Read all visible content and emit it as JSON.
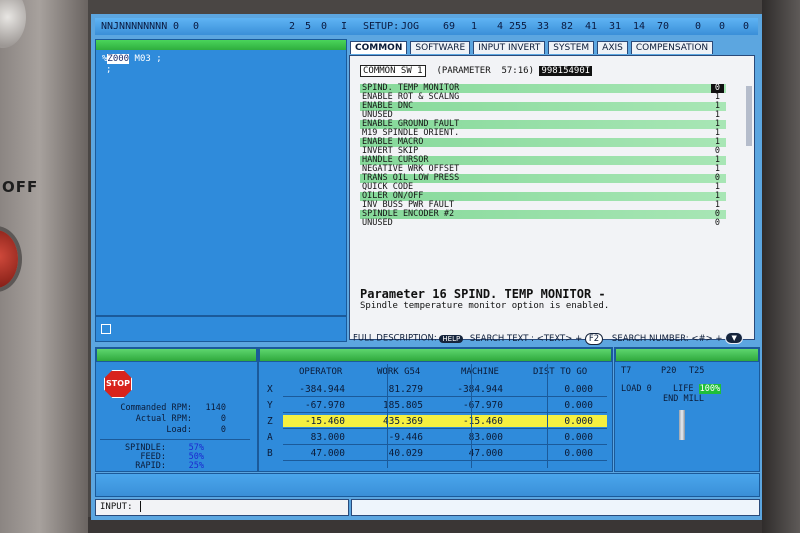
{
  "topbar": {
    "serial": "NNJNNNNNNNN",
    "n0": "0",
    "n1": "0",
    "c2": "2",
    "c5": "5",
    "c0": "0",
    "c1": "I",
    "setup": "SETUP:",
    "mode": "JOG",
    "v1": "69",
    "v2": "1",
    "v3": "4",
    "v4": "255",
    "v5": "33",
    "v6": "82",
    "v7": "41",
    "v8": "31",
    "v9": "14",
    "v10": "70",
    "v11": "0",
    "v12": "0",
    "v13": "0"
  },
  "program": {
    "line1_prefix": "%",
    "line1_block": "Z000",
    "line1_rest": " M03 ;",
    "line2": ";"
  },
  "tabs": [
    "COMMON",
    "SOFTWARE",
    "INPUT INVERT",
    "SYSTEM",
    "AXIS",
    "COMPENSATION"
  ],
  "params": {
    "header_name": "COMMON SW 1",
    "header_param": "(PARAMETER  57:16)",
    "header_value": "99815490I",
    "rows": [
      {
        "label": "SPIND. TEMP MONITOR",
        "value": "0"
      },
      {
        "label": "ENABLE ROT & SCALNG",
        "value": "1"
      },
      {
        "label": "ENABLE DNC",
        "value": "1"
      },
      {
        "label": "UNUSED",
        "value": "1"
      },
      {
        "label": "ENABLE GROUND FAULT",
        "value": "1"
      },
      {
        "label": "M19 SPINDLE ORIENT.",
        "value": "1"
      },
      {
        "label": "ENABLE MACRO",
        "value": "1"
      },
      {
        "label": "INVERT SKIP",
        "value": "0"
      },
      {
        "label": "HANDLE CURSOR",
        "value": "1"
      },
      {
        "label": "NEGATIVE WRK OFFSET",
        "value": "1"
      },
      {
        "label": "TRANS OIL LOW PRESS",
        "value": "0"
      },
      {
        "label": "QUICK CODE",
        "value": "1"
      },
      {
        "label": "OILER ON/OFF",
        "value": "1"
      },
      {
        "label": "INV BUSS PWR FAULT",
        "value": "1"
      },
      {
        "label": "SPINDLE ENCODER #2",
        "value": "0"
      },
      {
        "label": "UNUSED",
        "value": "0"
      }
    ],
    "desc_title": "Parameter 16 SPIND. TEMP MONITOR -",
    "desc_text": "Spindle temperature monitor option is enabled."
  },
  "help_bar": {
    "full_desc": "FULL DESCRIPTION:",
    "help_key": "HELP",
    "search_text": "SEARCH TEXT : <TEXT> +",
    "f2_key": "F2",
    "search_number": "SEARCH NUMBER: <#> +"
  },
  "spindle": {
    "stop_label": "STOP",
    "commanded_rpm_label": "Commanded RPM:",
    "commanded_rpm": "1140",
    "actual_rpm_label": "Actual RPM:",
    "actual_rpm": "0",
    "load_label": "Load:",
    "load": "0",
    "spindle_label": "SPINDLE:",
    "spindle_pct": "57%",
    "feed_label": "FEED:",
    "feed_pct": "50%",
    "rapid_label": "RAPID:",
    "rapid_pct": "25%"
  },
  "positions": {
    "headers": [
      "OPERATOR",
      "WORK G54",
      "MACHINE",
      "DIST TO GO"
    ],
    "rows": [
      {
        "axis": "X",
        "operator": "-384.944",
        "work": "81.279",
        "machine": "-384.944",
        "dist": "0.000"
      },
      {
        "axis": "Y",
        "operator": "-67.970",
        "work": "185.805",
        "machine": "-67.970",
        "dist": "0.000"
      },
      {
        "axis": "Z",
        "operator": "-15.460",
        "work": "435.369",
        "machine": "-15.460",
        "dist": "0.000"
      },
      {
        "axis": "A",
        "operator": "83.000",
        "work": "-9.446",
        "machine": "83.000",
        "dist": "0.000"
      },
      {
        "axis": "B",
        "operator": "47.000",
        "work": "40.029",
        "machine": "47.000",
        "dist": "0.000"
      }
    ]
  },
  "tool": {
    "tool_no": "T7",
    "pocket": "P20",
    "t_next": "T25",
    "load_label": "LOAD",
    "load_value": "0",
    "life_label": "LIFE",
    "life_value": "100%",
    "type": "END MILL"
  },
  "input": {
    "label": "INPUT:"
  },
  "colors": {
    "screen_bg": "#5ca6e0",
    "panel_bg": "#2f8bdb",
    "accent_green": "#3cc44c",
    "highlight_yellow": "#f6f040",
    "stop_red": "#d8231c"
  }
}
